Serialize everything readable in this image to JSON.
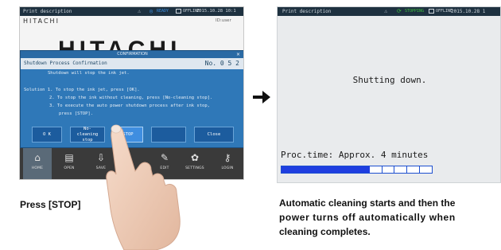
{
  "left_screen": {
    "statusbar": {
      "title": "Print description",
      "ready": "READY",
      "offline": "OFFLINE",
      "time": "2015.10.28 10:1"
    },
    "brand": "HITACHI",
    "user": "ID:user",
    "bigtext": "HITACHI, LTD.",
    "dialog": {
      "titlebar": "CONFIRMATION",
      "close": "×",
      "header_title": "Shutdown Process Confirmation",
      "header_no": "No. 0 5 2",
      "lines": [
        "Shutdown will stop the ink jet.",
        "Solution 1. To stop the ink jet, press [OK].",
        "2. To stop the ink without cleaning, press [No-cleaning stop].",
        "3. To execute the auto power shutdown process after ink stop,",
        "press [STOP]."
      ],
      "buttons": {
        "ok": "O K",
        "no_cleaning_stop": "No-cleaning stop",
        "stop": "STOP",
        "blank": "",
        "close": "Close"
      }
    },
    "toolbar": [
      {
        "icon": "home-icon",
        "label": "HOME"
      },
      {
        "icon": "open-icon",
        "label": "OPEN"
      },
      {
        "icon": "save-icon",
        "label": "SAVE"
      },
      {
        "icon": "blank",
        "label": ""
      },
      {
        "icon": "edit-icon",
        "label": "EDIT"
      },
      {
        "icon": "settings-icon",
        "label": "SETTINGS"
      },
      {
        "icon": "login-icon",
        "label": "LOGIN"
      }
    ]
  },
  "caption_left": "Press [STOP]",
  "right_screen": {
    "statusbar": {
      "title": "Print description",
      "stopping": "STOPPING",
      "offline": "OFFLINE",
      "time": "2015.10.28 1"
    },
    "message": "Shutting down.",
    "proc_time": "Proc.time: Approx. 4 minutes",
    "progress": {
      "filled": 7,
      "total": 12
    }
  },
  "caption_right": [
    "Automatic cleaning starts and then the",
    "power turns off automatically when",
    "cleaning completes."
  ],
  "colors": {
    "dialog": "#2f78b8",
    "statusbar": "#1e3140",
    "progress": "#1f3ee0"
  }
}
